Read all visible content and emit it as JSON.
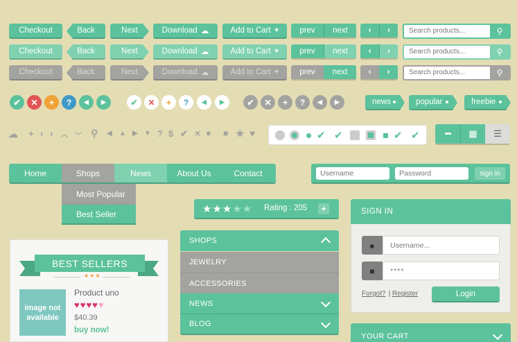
{
  "buttons": {
    "checkout": "Checkout",
    "back": "Back",
    "next": "Next",
    "download": "Download",
    "add_to_cart": "Add to Cart",
    "prev": "prev",
    "next_lower": "next"
  },
  "search": {
    "placeholder": "Search products..."
  },
  "tags": {
    "news": "news",
    "popular": "popular",
    "freebie": "freebie"
  },
  "glyph_row": {
    "q": "?",
    "dollar": "$",
    "check": "✔",
    "times": "×",
    "star": "★",
    "heart": "♥"
  },
  "nav": {
    "items": [
      "Home",
      "Shops",
      "News",
      "About Us",
      "Contact"
    ],
    "active": "Shops",
    "dropdown": [
      "Most Popular",
      "Best Seller"
    ]
  },
  "login_bar": {
    "username": "Username",
    "password": "Password",
    "signin": "sign in"
  },
  "rating": {
    "label": "Rating : 205",
    "stars_filled": 3,
    "stars_total": 5,
    "plus": "+"
  },
  "accordion": {
    "items": [
      "SHOPS",
      "JEWELRY",
      "ACCESSORIES",
      "NEWS",
      "BLOG"
    ]
  },
  "product": {
    "ribbon": "BEST SELLERS",
    "stars": "★★★",
    "image_text": "image not available",
    "name": "Product uno",
    "hearts_filled": 4,
    "hearts_total": 5,
    "price": "$40.39",
    "buy": "buy now!"
  },
  "signin": {
    "title": "SIGN IN",
    "username_ph": "Username...",
    "password_ph": "****",
    "forgot": "Forgot?",
    "sep": " | ",
    "register": "Register",
    "login": "Login"
  },
  "cart": {
    "title": "YOUR CART"
  },
  "colors": {
    "accent": "#5cc29c",
    "accent_light": "#7fd1b0",
    "gray": "#a3a39f",
    "red": "#e25555",
    "orange": "#f0a236",
    "blue": "#3f9ac7",
    "background": "#e4ddb4"
  }
}
